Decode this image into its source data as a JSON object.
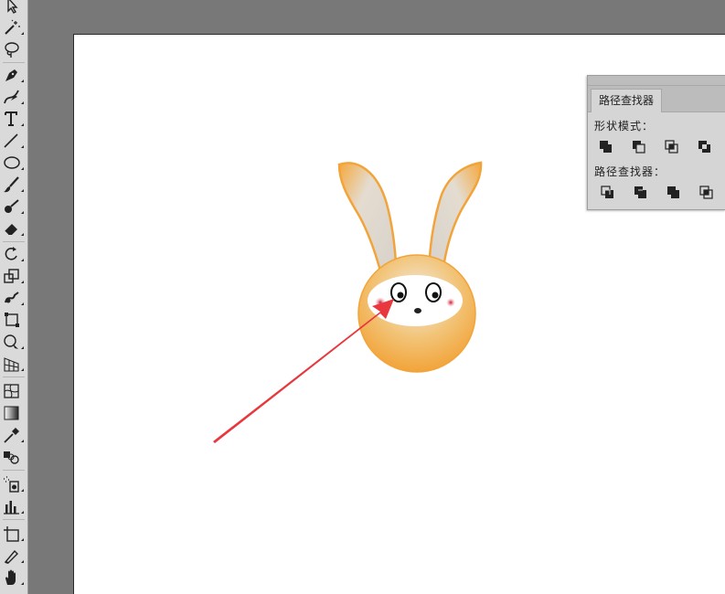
{
  "pathfinder_panel": {
    "tab_label": "路径查找器",
    "shape_modes_label": "形状模式：",
    "pathfinders_label": "路径查找器：",
    "shape_mode_buttons": [
      "unite",
      "minus-front",
      "intersect",
      "exclude"
    ],
    "pathfinder_buttons": [
      "divide",
      "trim",
      "merge",
      "crop"
    ]
  },
  "toolbar": {
    "tools": [
      "direct-selection",
      "magic-wand",
      "lasso",
      "pen",
      "curvature",
      "type",
      "line-segment",
      "ellipse",
      "paintbrush",
      "blob-brush",
      "eraser",
      "rotate",
      "scale",
      "warp",
      "free-transform",
      "shape-builder",
      "perspective-grid",
      "mesh",
      "gradient",
      "eyedropper",
      "blend",
      "symbol-sprayer",
      "column-graph",
      "artboard",
      "slice",
      "hand"
    ]
  },
  "colors": {
    "rabbit_orange": "#f3a637",
    "rabbit_cream": "#efe7db",
    "face_white": "#ffffff",
    "cheek_red": "#d9283a",
    "arrow_red": "#e8383d"
  }
}
